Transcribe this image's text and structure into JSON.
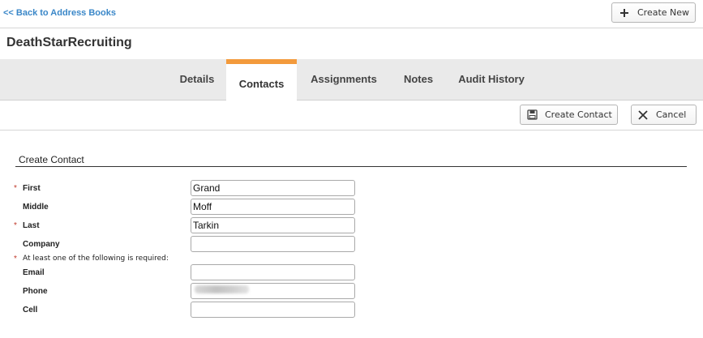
{
  "header": {
    "back_label": "<< Back to Address Books",
    "create_new_label": "Create New",
    "title": "DeathStarRecruiting"
  },
  "tabs": [
    {
      "label": "Details",
      "active": false
    },
    {
      "label": "Contacts",
      "active": true
    },
    {
      "label": "Assignments",
      "active": false
    },
    {
      "label": "Notes",
      "active": false
    },
    {
      "label": "Audit History",
      "active": false
    }
  ],
  "actions": {
    "create_contact_label": "Create Contact",
    "cancel_label": "Cancel"
  },
  "form": {
    "section_title": "Create Contact",
    "required_marker": "*",
    "required_note": "At least one of the following is required:",
    "fields": {
      "first": {
        "label": "First",
        "value": "Grand"
      },
      "middle": {
        "label": "Middle",
        "value": "Moff"
      },
      "last": {
        "label": "Last",
        "value": "Tarkin"
      },
      "company": {
        "label": "Company",
        "value": ""
      },
      "email": {
        "label": "Email",
        "value": ""
      },
      "phone": {
        "label": "Phone",
        "value": ""
      },
      "cell": {
        "label": "Cell",
        "value": ""
      }
    }
  },
  "icons": {
    "create_new": "plus-icon",
    "create_contact": "save-icon",
    "cancel": "close-icon"
  },
  "colors": {
    "link": "#3a87c8",
    "active_tab_accent": "#f39a3c",
    "tab_bar_bg": "#eaeaea",
    "required_marker": "#c0392b"
  }
}
